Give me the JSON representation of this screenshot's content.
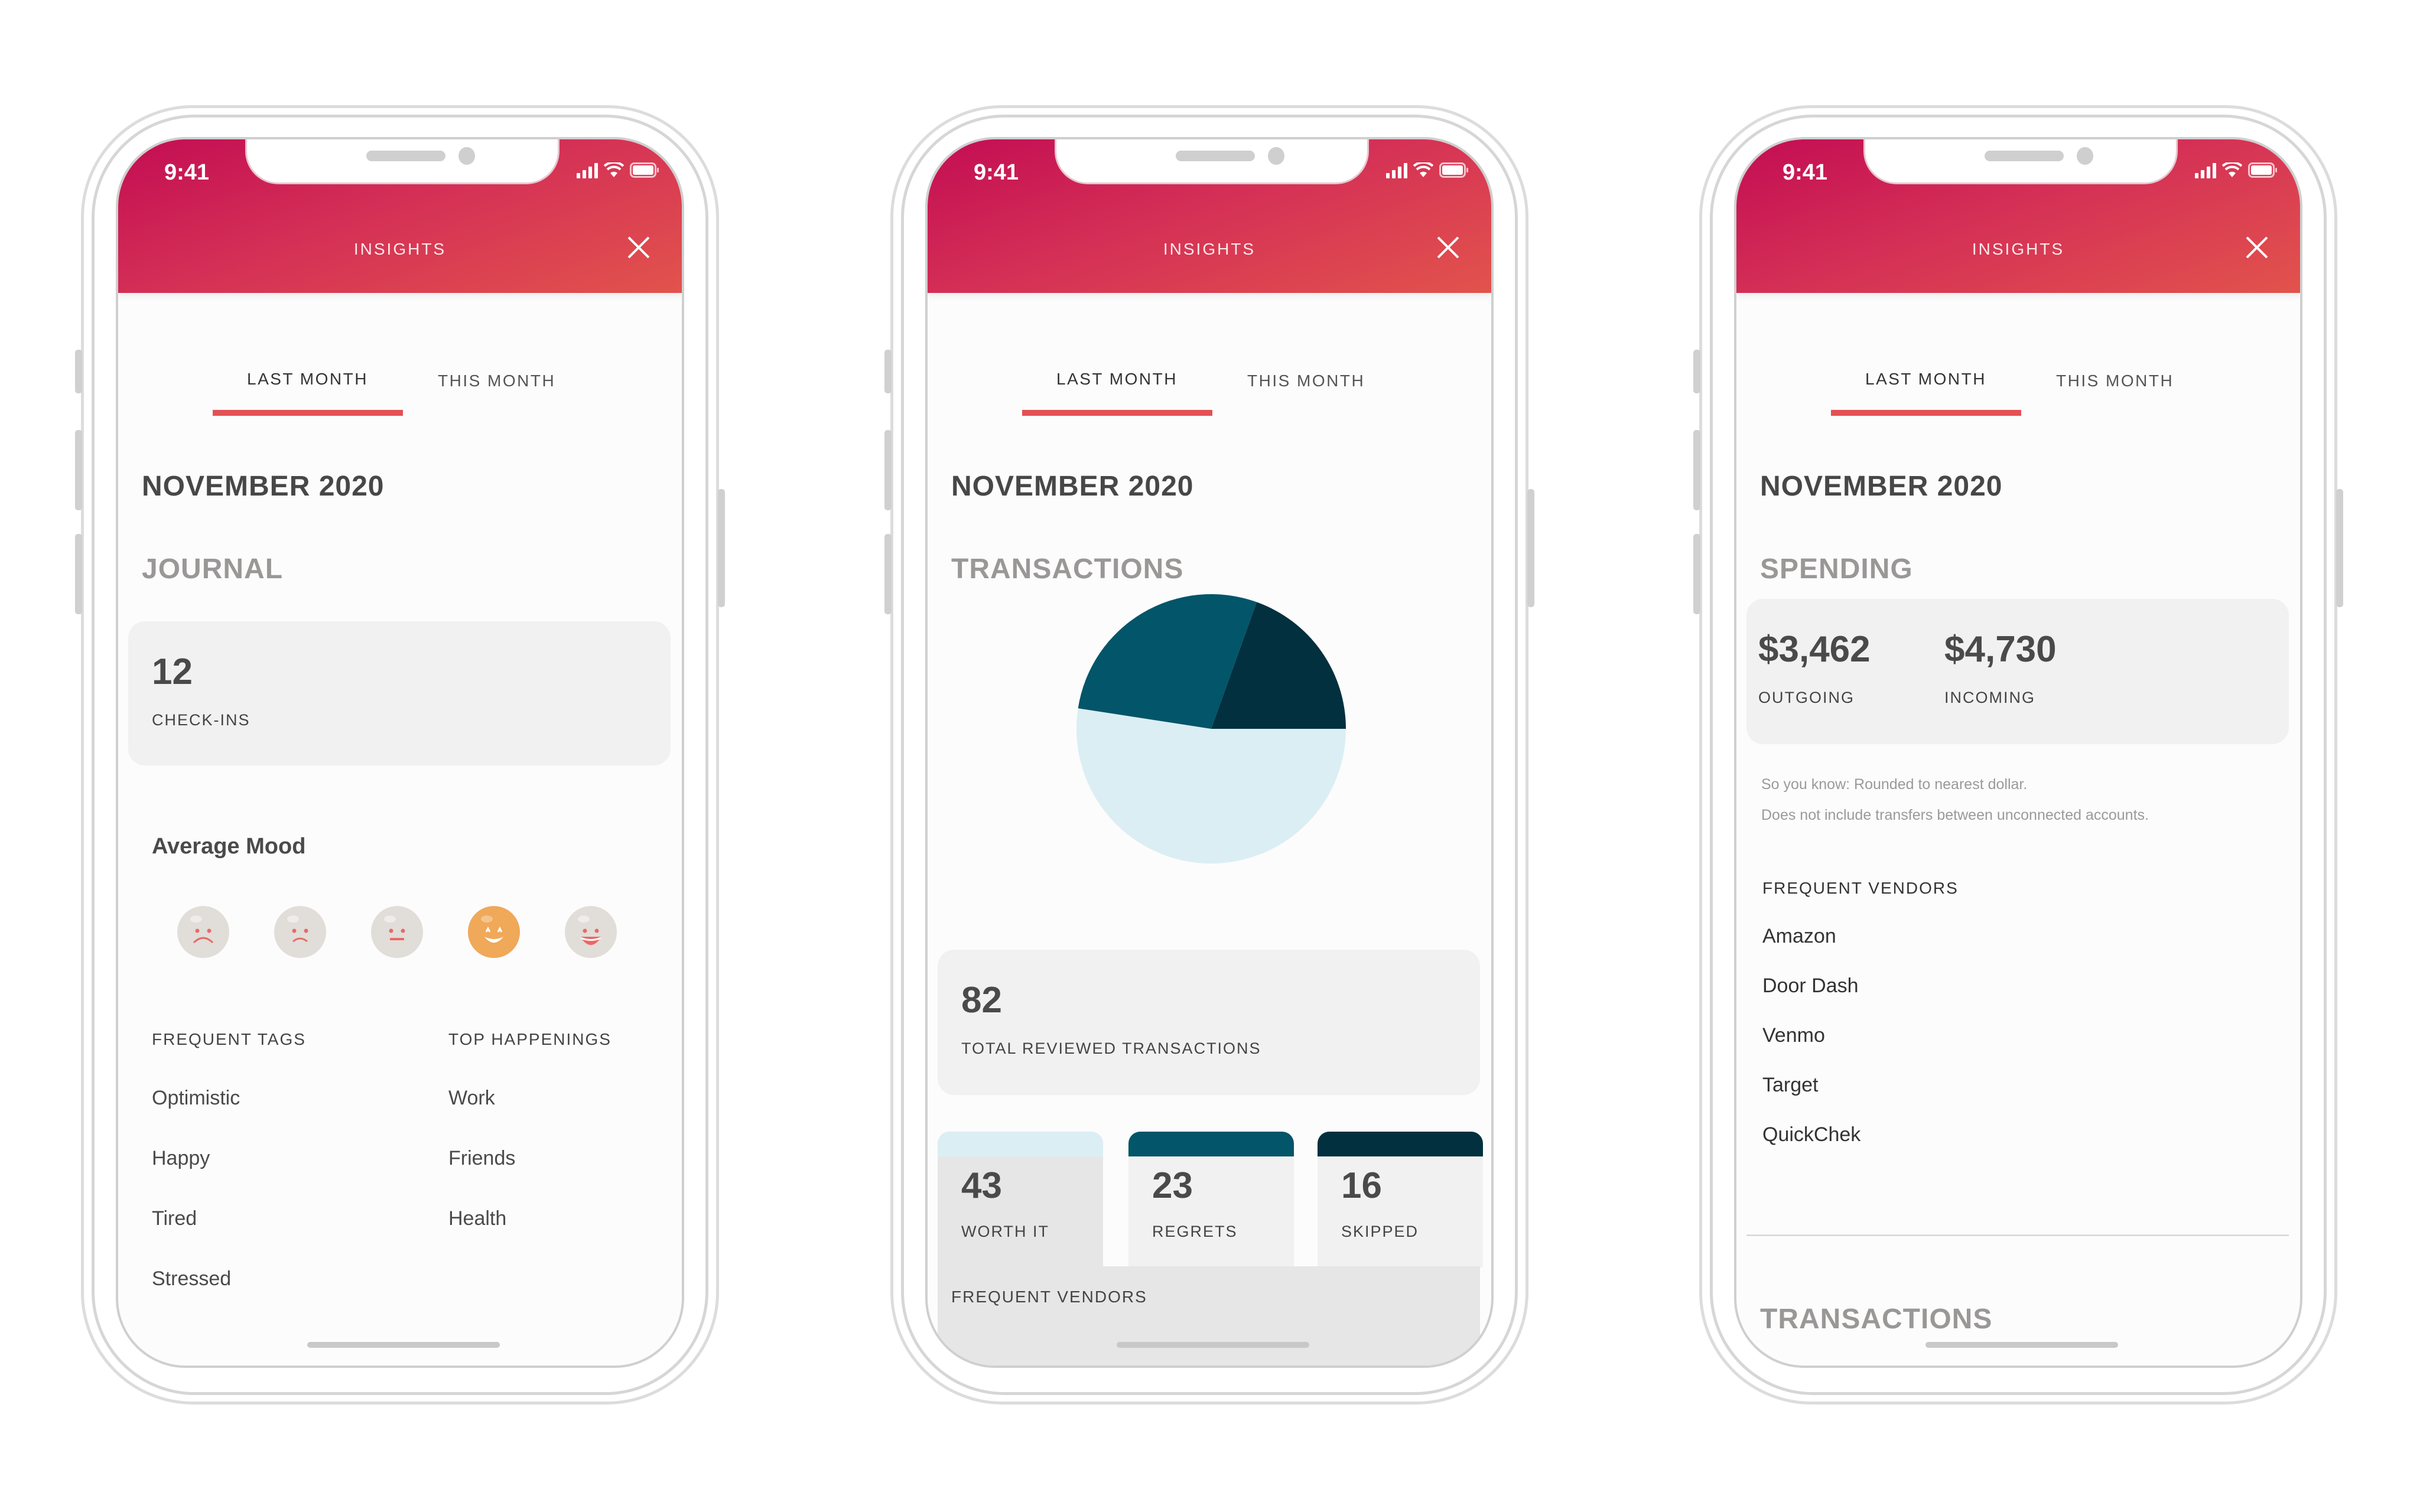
{
  "status_bar": {
    "time": "9:41"
  },
  "header": {
    "title": "INSIGHTS"
  },
  "tabs": [
    {
      "label": "LAST MONTH",
      "active": true
    },
    {
      "label": "THIS MONTH",
      "active": false
    }
  ],
  "month": "NOVEMBER 2020",
  "colors": {
    "header_gradient": [
      "#c30d53",
      "#e2534c"
    ],
    "tab_underline": "#e35155",
    "worth_it": "#dbeef3",
    "regrets": "#035569",
    "skipped": "#02303f",
    "mood_selected": "#f0a859",
    "mood_default": "#e1ddd8"
  },
  "journal": {
    "section_title": "JOURNAL",
    "checkins_value": "12",
    "checkins_label": "CHECK-INS",
    "mood_title": "Average Mood",
    "moods": [
      {
        "name": "very-sad",
        "selected": false
      },
      {
        "name": "sad",
        "selected": false
      },
      {
        "name": "neutral",
        "selected": false
      },
      {
        "name": "happy",
        "selected": true
      },
      {
        "name": "very-happy",
        "selected": false
      }
    ],
    "frequent_tags_label": "FREQUENT TAGS",
    "frequent_tags": [
      "Optimistic",
      "Happy",
      "Tired",
      "Stressed"
    ],
    "top_happenings_label": "TOP HAPPENINGS",
    "top_happenings": [
      "Work",
      "Friends",
      "Health"
    ]
  },
  "transactions": {
    "section_title": "TRANSACTIONS",
    "total_value": "82",
    "total_label": "TOTAL REVIEWED TRANSACTIONS",
    "breakdown": [
      {
        "value": "43",
        "label": "WORTH IT"
      },
      {
        "value": "23",
        "label": "REGRETS"
      },
      {
        "value": "16",
        "label": "SKIPPED"
      }
    ],
    "frequent_vendors_label": "FREQUENT VENDORS"
  },
  "chart_data": {
    "type": "pie",
    "title": "",
    "categories": [
      "Worth it",
      "Regrets",
      "Skipped"
    ],
    "values": [
      43,
      23,
      16
    ],
    "colors": [
      "#dbeef3",
      "#035569",
      "#02303f"
    ]
  },
  "spending": {
    "section_title": "SPENDING",
    "outgoing_value": "$3,462",
    "outgoing_label": "OUTGOING",
    "incoming_value": "$4,730",
    "incoming_label": "INCOMING",
    "note_line1": "So you know: Rounded to nearest dollar.",
    "note_line2": "Does not include transfers between unconnected accounts.",
    "frequent_vendors_label": "FREQUENT VENDORS",
    "vendors": [
      "Amazon",
      "Door Dash",
      "Venmo",
      "Target",
      "QuickChek"
    ],
    "next_section_title": "TRANSACTIONS"
  }
}
